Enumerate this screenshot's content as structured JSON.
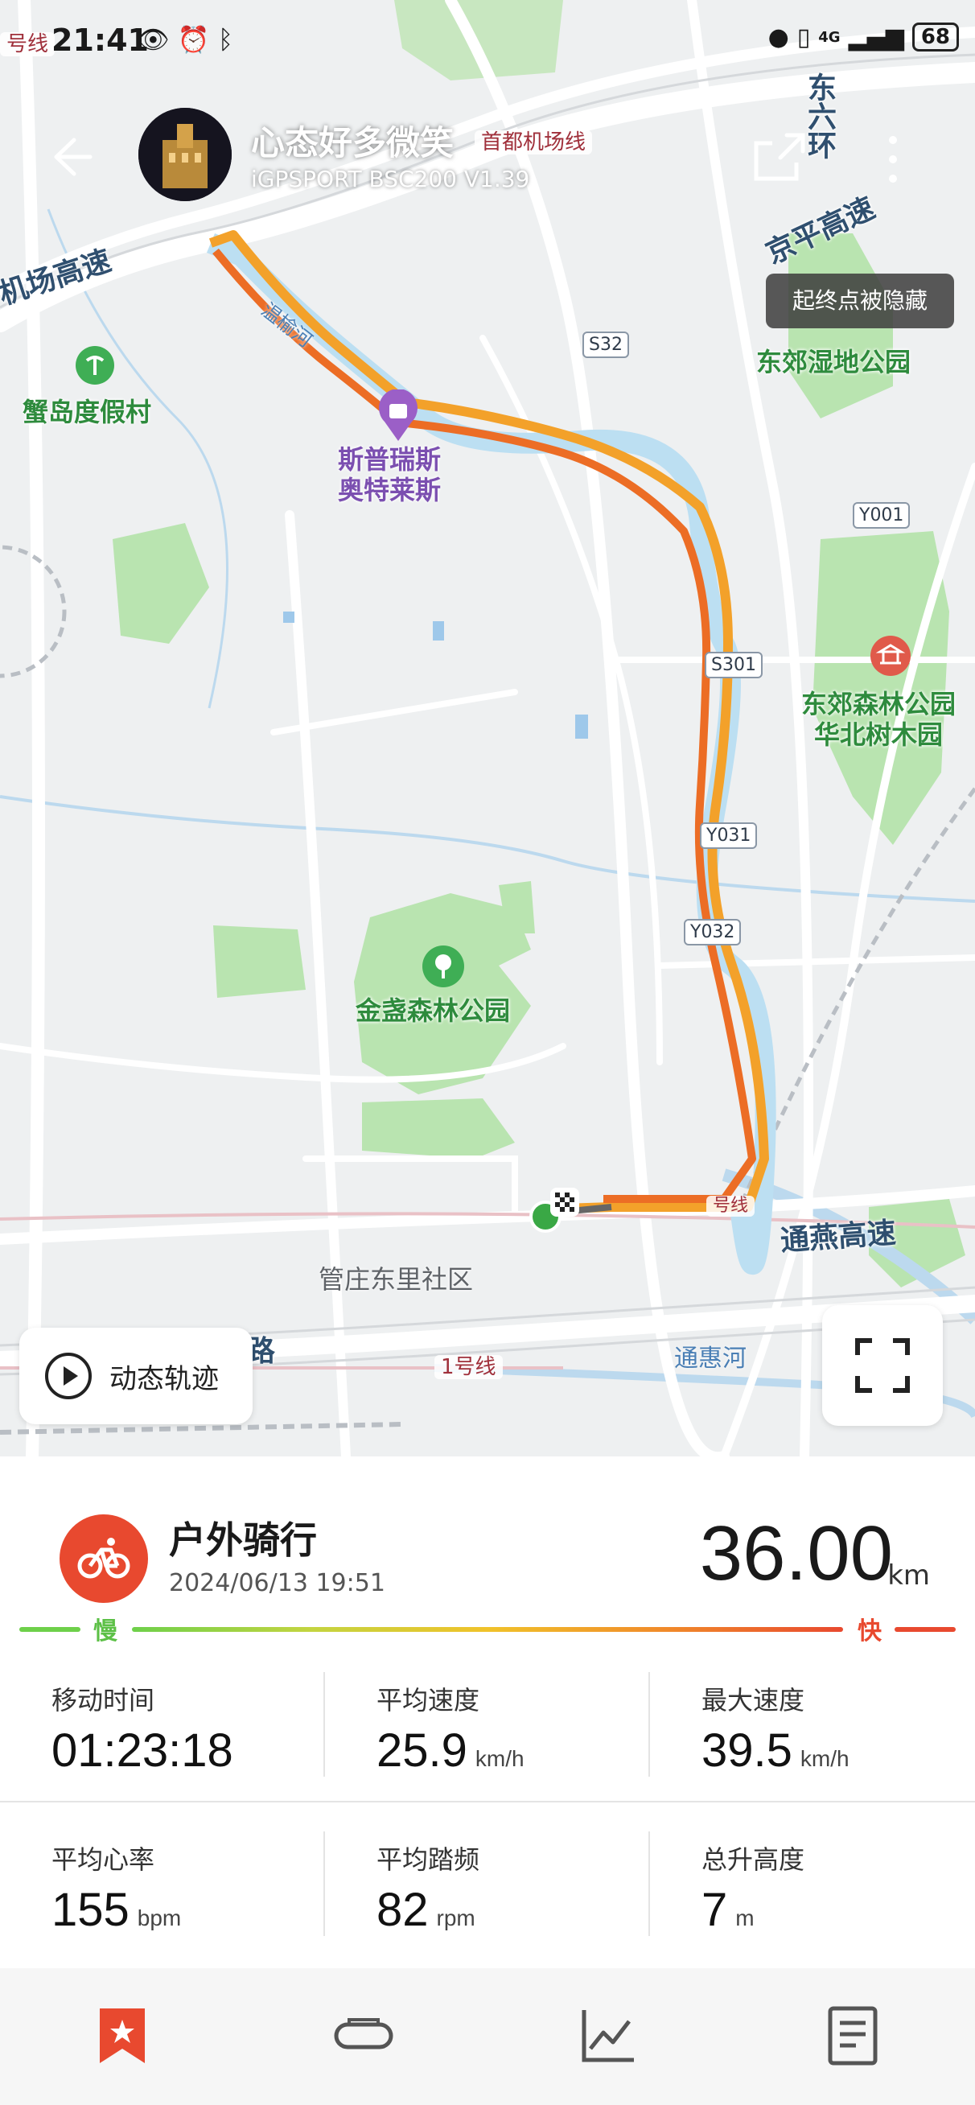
{
  "status_bar": {
    "time": "21:41",
    "battery": "68",
    "network": "4G"
  },
  "header": {
    "user_name": "心态好多微笑",
    "device": "iGPSPORT BSC200  V1.39"
  },
  "map": {
    "tip": "起终点被隐藏",
    "labels": {
      "airport_line": "首都机场线",
      "airport_expwy": "机场高速",
      "east6": "东六环",
      "jingping": "京平高速",
      "xiedao": "蟹岛度假村",
      "prime": "斯普瑞斯\n奥特莱斯",
      "dongjiao_wetland": "东郊湿地公园",
      "dongjiao_forest": "东郊森林公园\n华北树木园",
      "jinzhan": "金盏森林公园",
      "guanzhuang": "管庄东里社区",
      "tongyan": "通燕高速",
      "tonghui": "通惠河",
      "line1": "1号线",
      "line1_top": "号线",
      "road_lu": "路",
      "river": "温榆河",
      "s32": "S32",
      "y001": "Y001",
      "s301": "S301",
      "y031": "Y031",
      "y032": "Y032",
      "line_near_end": "号线"
    },
    "dynamic_track_label": "动态轨迹"
  },
  "activity": {
    "title": "户外骑行",
    "datetime": "2024/06/13 19:51",
    "distance": "36.00",
    "distance_unit": "km",
    "slow_label": "慢",
    "fast_label": "快"
  },
  "stats": [
    {
      "label": "移动时间",
      "value": "01:23:18",
      "unit": ""
    },
    {
      "label": "平均速度",
      "value": "25.9",
      "unit": "km/h"
    },
    {
      "label": "最大速度",
      "value": "39.5",
      "unit": "km/h"
    },
    {
      "label": "平均心率",
      "value": "155",
      "unit": "bpm"
    },
    {
      "label": "平均踏频",
      "value": "82",
      "unit": "rpm"
    },
    {
      "label": "总升高度",
      "value": "7",
      "unit": "m"
    }
  ],
  "colors": {
    "accent": "#e8492f",
    "slow": "#6ed04a",
    "route": "#f08a2a",
    "park": "#b9e4b0",
    "water": "#bcd9ee"
  },
  "nav_icons": [
    "star-tab-icon",
    "device-tab-icon",
    "chart-tab-icon",
    "document-tab-icon"
  ]
}
